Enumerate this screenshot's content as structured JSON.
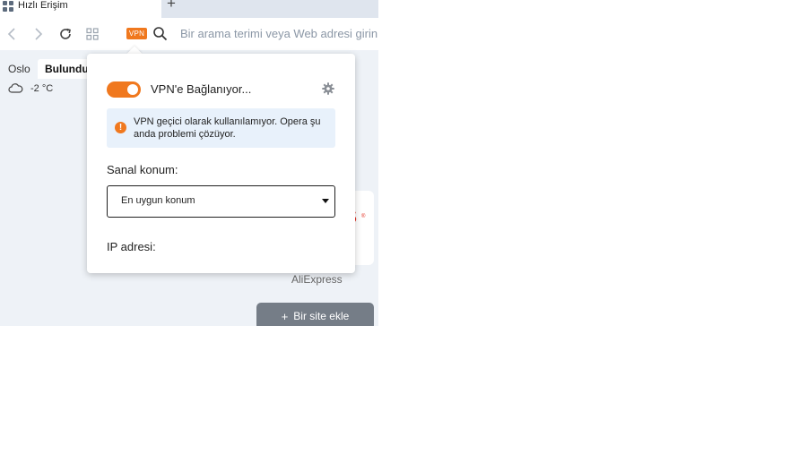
{
  "tab": {
    "title": "Hızlı Erişim",
    "new_tab_symbol": "+"
  },
  "toolbar": {
    "vpn_badge": "VPN",
    "address_placeholder": "Bir arama terimi veya Web adresi girin"
  },
  "speed_dial": {
    "city": "Oslo",
    "location_tab": "Bulundu",
    "temperature": "-2 °C",
    "aliexpress_label": "AliExpress",
    "add_site": {
      "plus": "+",
      "label": "Bir site ekle"
    }
  },
  "vpn_popup": {
    "toggle_on": true,
    "status": "VPN'e Bağlanıyor...",
    "info_icon": "!",
    "info_message": "VPN geçici olarak kullanılamıyor. Opera şu anda problemi çözüyor.",
    "location_label": "Sanal konum:",
    "location_value": "En uygun konum",
    "ip_label": "IP adresi:"
  },
  "colors": {
    "accent": "#f0781e",
    "info_bg": "#e8f1fb",
    "page_bg": "#eef2f7"
  }
}
